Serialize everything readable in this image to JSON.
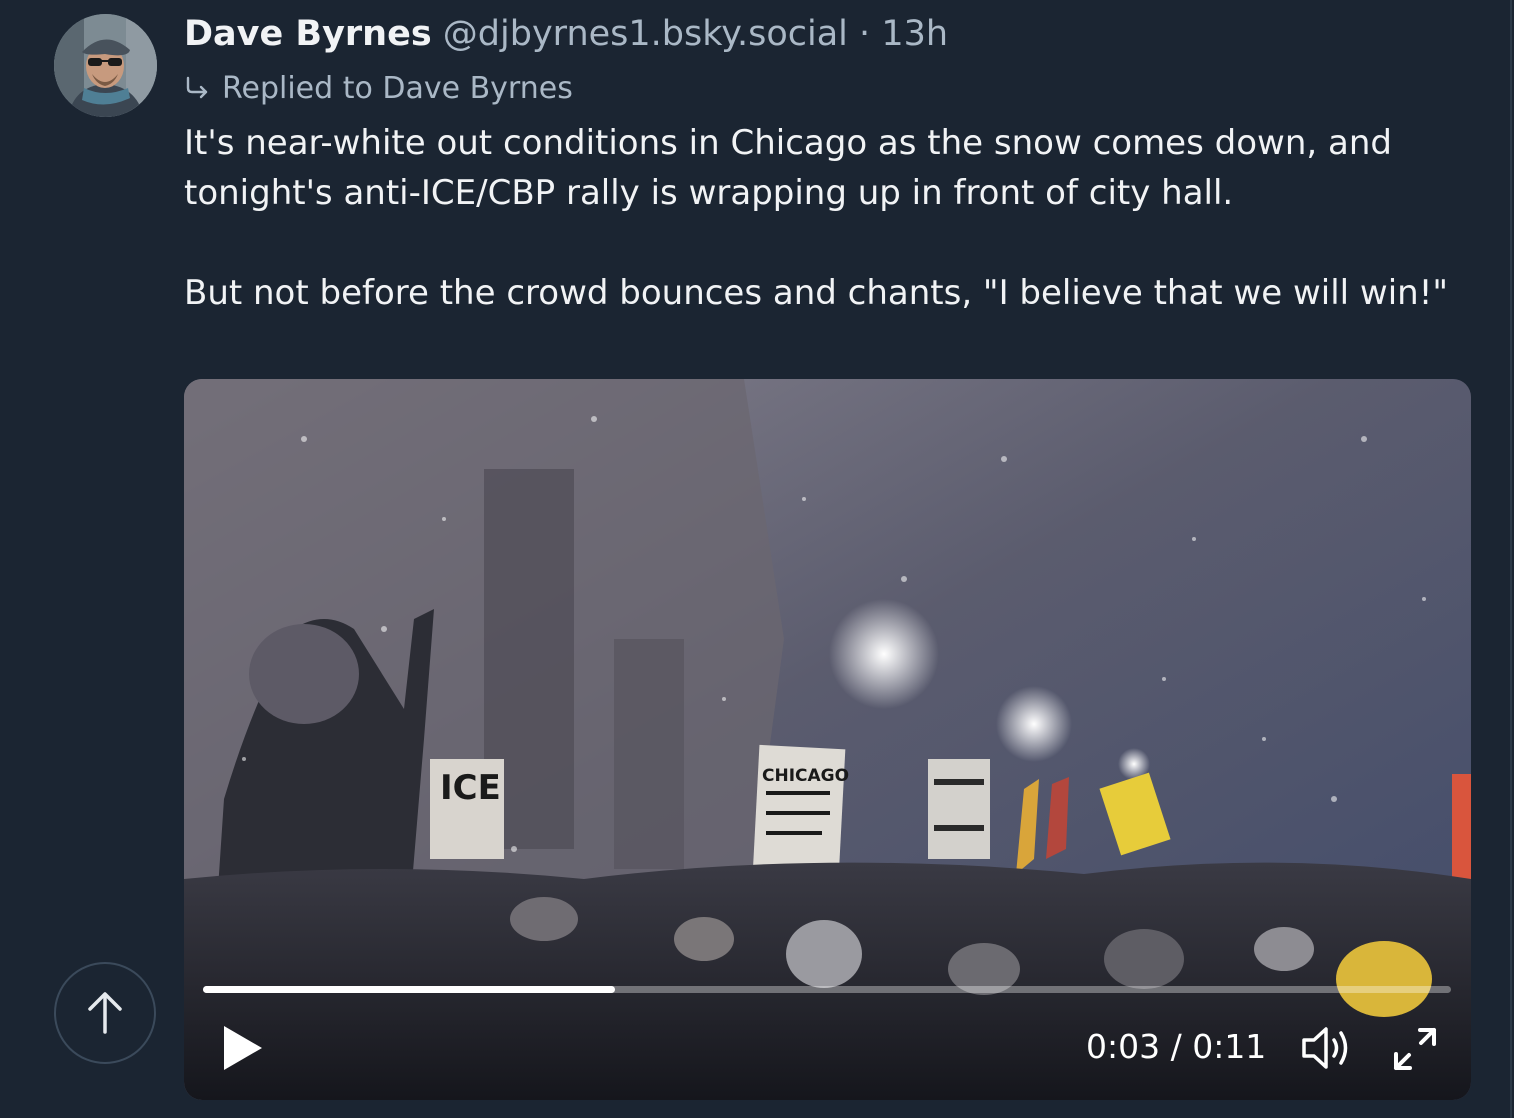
{
  "post": {
    "author": {
      "display_name": "Dave Byrnes",
      "handle": "@djbyrnes1.bsky.social"
    },
    "separator": "·",
    "timestamp": "13h",
    "reply_context": "Replied to Dave Byrnes",
    "text_paragraphs": [
      "It's near-white out conditions in Chicago as the snow comes down, and tonight's anti-ICE/CBP rally is wrapping up in front of city hall.",
      "But not before the crowd bounces and chants, \"I believe that we will win!\""
    ],
    "video": {
      "time_display": "0:03 / 0:11",
      "progress_fraction": 0.33,
      "sign_texts": [
        "ICE",
        "CHICAGO"
      ]
    }
  },
  "icons": {
    "reply": "reply-arrow-icon",
    "play": "play-icon",
    "volume": "volume-icon",
    "fullscreen": "fullscreen-icon",
    "scroll_top": "arrow-up-icon"
  },
  "colors": {
    "background": "#1b2532",
    "text_primary": "#f1f3f5",
    "text_secondary": "#aab8c6"
  }
}
